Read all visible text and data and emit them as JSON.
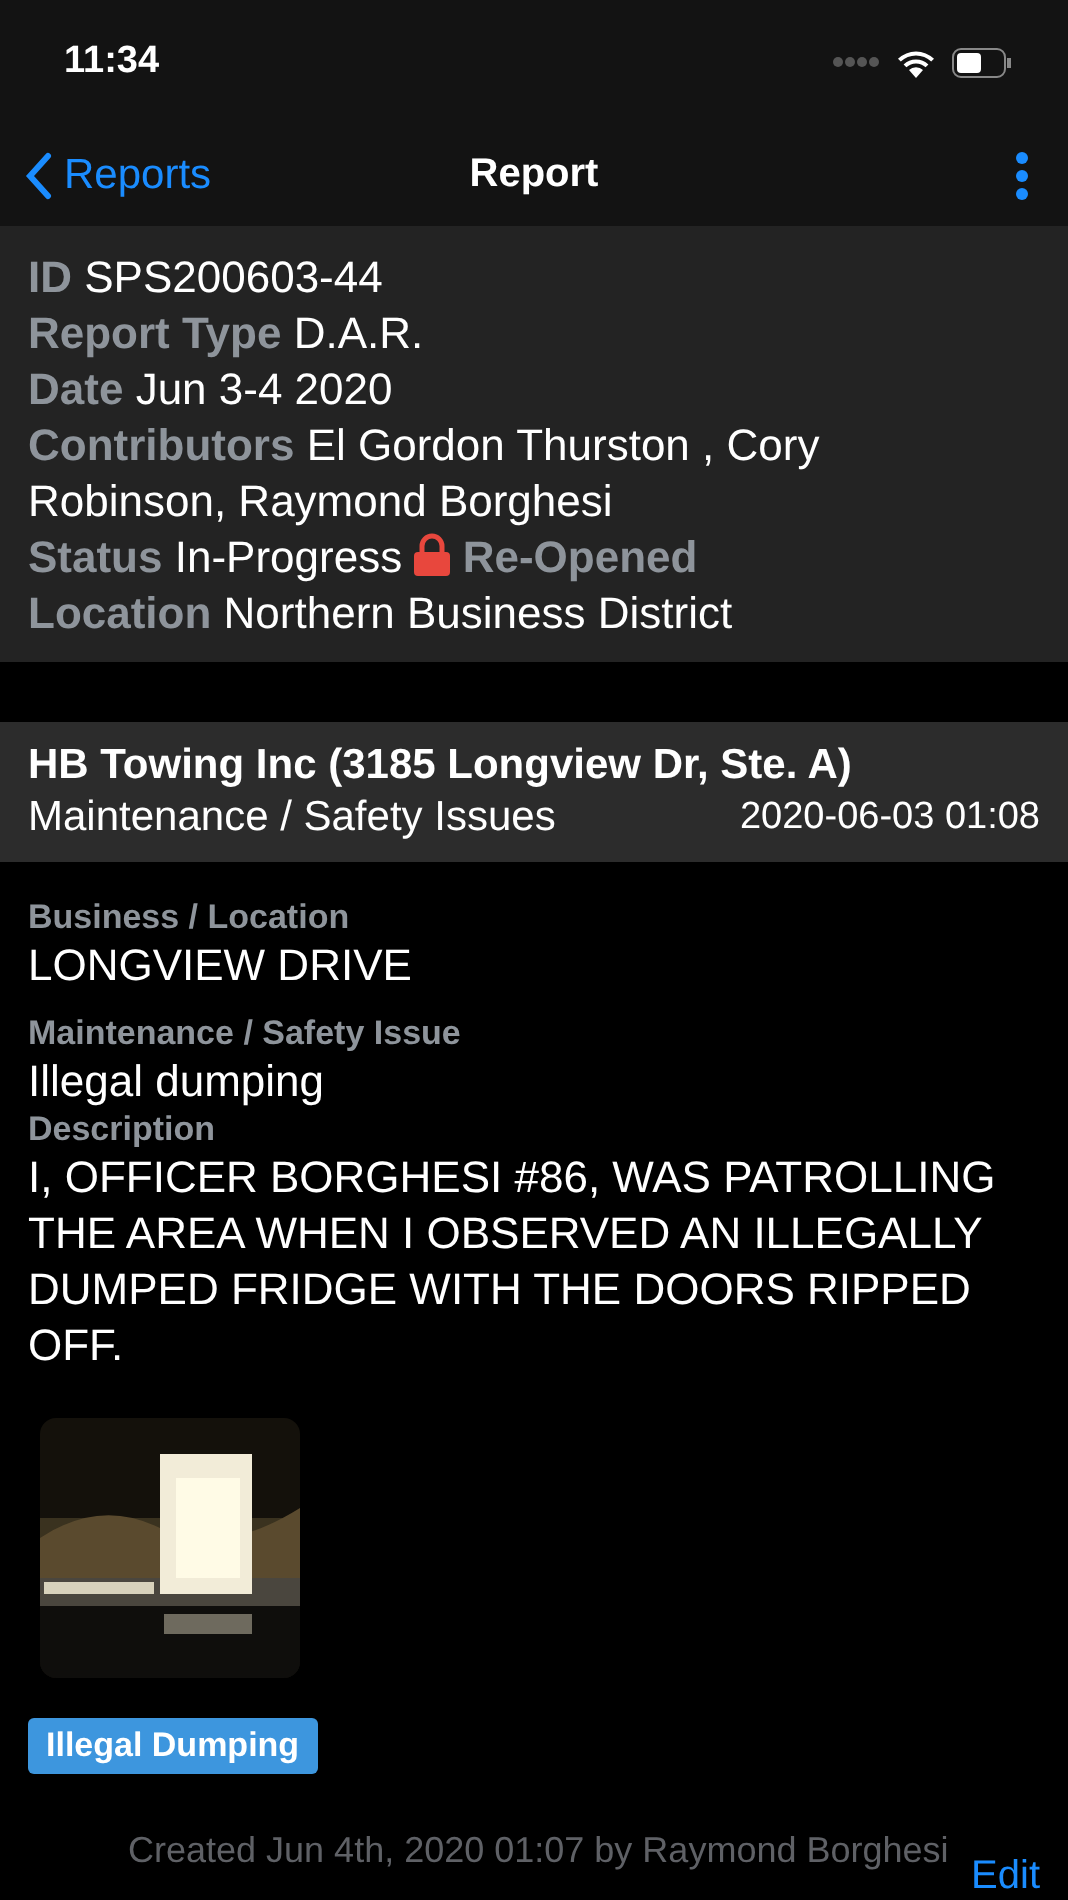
{
  "status_bar": {
    "time": "11:34"
  },
  "nav": {
    "back": "Reports",
    "title": "Report"
  },
  "summary": [
    {
      "label": "ID",
      "value": "SPS200603-44"
    },
    {
      "label": "Report Type",
      "value": "D.A.R."
    },
    {
      "label": "Date",
      "value": "Jun 3-4 2020"
    },
    {
      "label": "Contributors",
      "value": "El Gordon Thurston , Cory Robinson, Raymond Borghesi"
    },
    {
      "label": "Status",
      "value": "In-Progress",
      "locked": true,
      "flag": "Re-Opened"
    },
    {
      "label": "Location",
      "value": "Northern Business District"
    }
  ],
  "entry": {
    "title": "HB Towing Inc (3185 Longview Dr, Ste. A)",
    "category": "Maintenance / Safety Issues",
    "timestamp": "2020-06-03 01:08",
    "fields": [
      {
        "label": "Business / Location",
        "value": "LONGVIEW DRIVE"
      },
      {
        "label": "Maintenance / Safety Issue",
        "value": "Illegal dumping"
      },
      {
        "label": "Description",
        "value": "I, OFFICER BORGHESI #86, WAS PATROLLING THE AREA WHEN I OBSERVED AN ILLEGALLY DUMPED FRIDGE WITH THE DOORS RIPPED OFF."
      }
    ],
    "tags": [
      {
        "label": "Illegal Dumping",
        "color": "#3d96de"
      }
    ],
    "created": "Created Jun 4th, 2020 01:07 by Raymond Borghesi",
    "edit": "Edit"
  }
}
